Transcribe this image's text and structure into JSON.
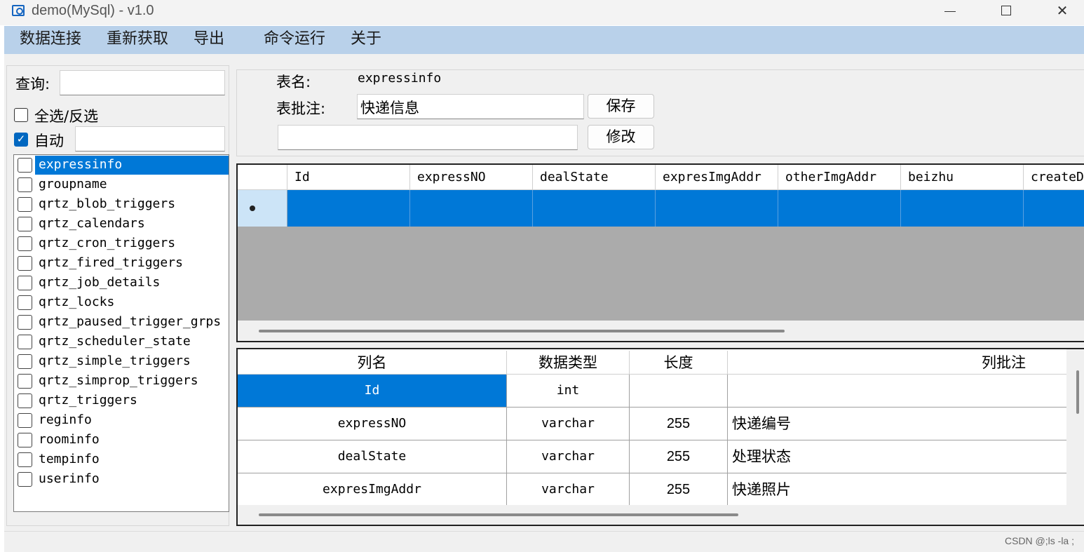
{
  "window": {
    "title": "demo(MySql) -  v1.0",
    "controls": {
      "minimize": "",
      "maximize": "",
      "close": "✕"
    }
  },
  "menu": [
    "数据连接",
    "重新获取",
    "导出",
    "命令运行",
    "关于"
  ],
  "left": {
    "query_label": "查询:",
    "query_value": "",
    "select_all_label": "全选/反选",
    "select_all_checked": false,
    "auto_label": "自动",
    "auto_checked": true,
    "auto_value": "",
    "tables": [
      {
        "name": "expressinfo",
        "checked": false,
        "selected": true
      },
      {
        "name": "groupname",
        "checked": false,
        "selected": false
      },
      {
        "name": "qrtz_blob_triggers",
        "checked": false,
        "selected": false
      },
      {
        "name": "qrtz_calendars",
        "checked": false,
        "selected": false
      },
      {
        "name": "qrtz_cron_triggers",
        "checked": false,
        "selected": false
      },
      {
        "name": "qrtz_fired_triggers",
        "checked": false,
        "selected": false
      },
      {
        "name": "qrtz_job_details",
        "checked": false,
        "selected": false
      },
      {
        "name": "qrtz_locks",
        "checked": false,
        "selected": false
      },
      {
        "name": "qrtz_paused_trigger_grps",
        "checked": false,
        "selected": false
      },
      {
        "name": "qrtz_scheduler_state",
        "checked": false,
        "selected": false
      },
      {
        "name": "qrtz_simple_triggers",
        "checked": false,
        "selected": false
      },
      {
        "name": "qrtz_simprop_triggers",
        "checked": false,
        "selected": false
      },
      {
        "name": "qrtz_triggers",
        "checked": false,
        "selected": false
      },
      {
        "name": "reginfo",
        "checked": false,
        "selected": false
      },
      {
        "name": "roominfo",
        "checked": false,
        "selected": false
      },
      {
        "name": "tempinfo",
        "checked": false,
        "selected": false
      },
      {
        "name": "userinfo",
        "checked": false,
        "selected": false
      }
    ]
  },
  "info": {
    "table_name_label": "表名:",
    "table_name": "expressinfo",
    "comment_label": "表批注:",
    "comment_value": "快递信息",
    "save_button": "保存",
    "extra_value": "",
    "modify_button": "修改"
  },
  "grid": {
    "columns": [
      "Id",
      "expressNO",
      "dealState",
      "expresImgAddr",
      "otherImgAddr",
      "beizhu",
      "createDa"
    ],
    "row_marker": "*"
  },
  "columns_table": {
    "headers": [
      "列名",
      "数据类型",
      "长度",
      "列批注"
    ],
    "rows": [
      {
        "name": "Id",
        "type": "int",
        "length": "",
        "comment": ""
      },
      {
        "name": "expressNO",
        "type": "varchar",
        "length": "255",
        "comment": "快递编号"
      },
      {
        "name": "dealState",
        "type": "varchar",
        "length": "255",
        "comment": "处理状态"
      },
      {
        "name": "expresImgAddr",
        "type": "varchar",
        "length": "255",
        "comment": "快递照片"
      }
    ]
  },
  "status": {
    "watermark": "CSDN @;ls -la ;"
  }
}
